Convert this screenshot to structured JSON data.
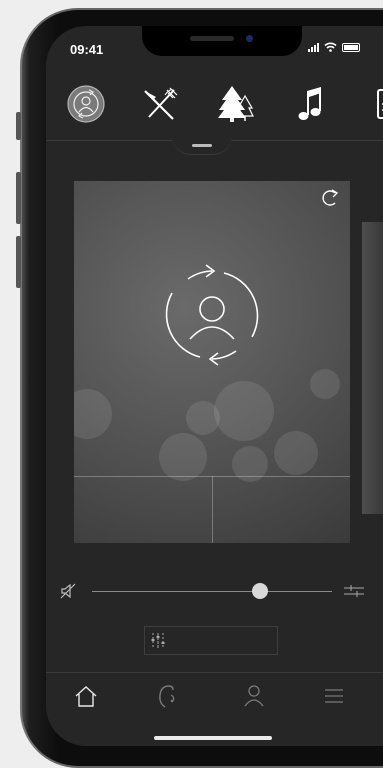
{
  "status_bar": {
    "time": "09:41"
  },
  "categories": [
    {
      "name": "self-awareness",
      "icon": "profile-cycle-icon",
      "selected": true
    },
    {
      "name": "dining",
      "icon": "fork-knife-icon"
    },
    {
      "name": "nature",
      "icon": "trees-icon"
    },
    {
      "name": "music",
      "icon": "music-note-icon"
    },
    {
      "name": "more",
      "icon": "partial-icon"
    }
  ],
  "card": {
    "icon": "profile-cycle-icon",
    "share_icon": "share-icon"
  },
  "volume": {
    "level": 0.7,
    "mute_icon": "speaker-muted-icon"
  },
  "equalizer": {
    "icon": "sliders-icon"
  },
  "tabs": [
    {
      "name": "home",
      "icon": "home-icon",
      "active": true
    },
    {
      "name": "hearing",
      "icon": "ear-icon"
    },
    {
      "name": "profile",
      "icon": "user-icon"
    },
    {
      "name": "menu",
      "icon": "menu-icon"
    }
  ],
  "colors": {
    "background": "#262626",
    "icon": "#ffffff",
    "accent": "#d8d8d8"
  }
}
